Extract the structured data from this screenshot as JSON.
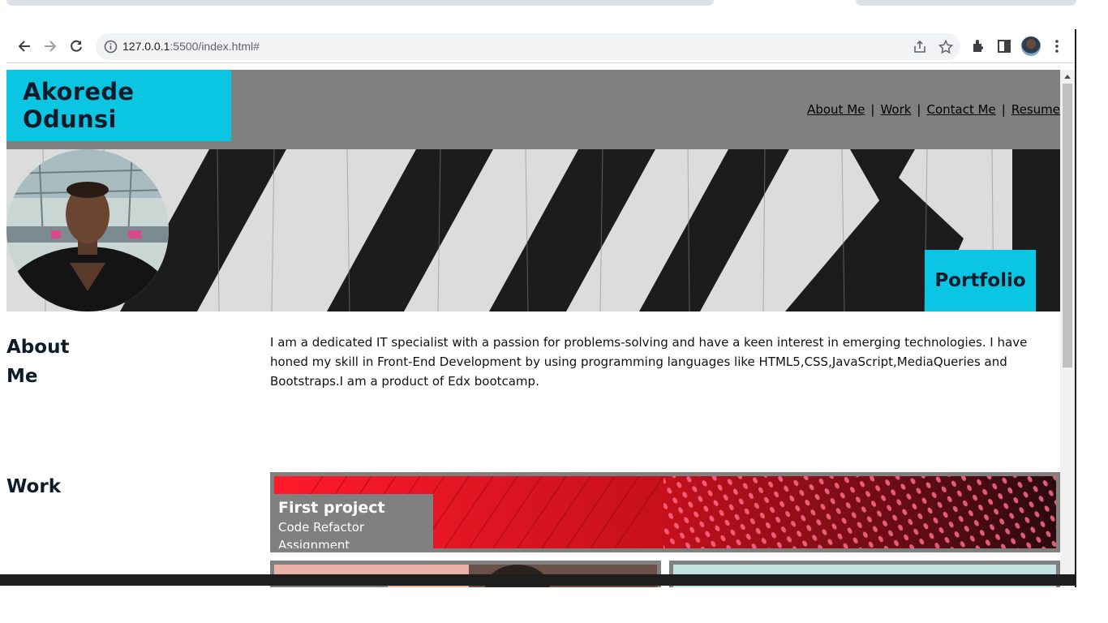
{
  "browser": {
    "url_host": "127.0.0.1",
    "url_path": ":5500/index.html#"
  },
  "site": {
    "logo": "Akorede Odunsi",
    "nav": [
      "About Me",
      "Work",
      "Contact Me",
      "Resume"
    ],
    "nav_separator": "|",
    "hero_tag": "Portfolio",
    "about_title_line1": "About",
    "about_title_line2": "Me",
    "about_text": "I am a dedicated IT specialist with a passion for problems-solving and have a keen interest in emerging technologies. I have honed my skill in Front-End Development by using programming languages like HTML5,CSS,JavaScript,MediaQueries and Bootstraps.I am a product of Edx bootcamp.",
    "work_title": "Work",
    "projects": [
      {
        "title": "First project",
        "subtitle": "Code Refactor Assignment"
      }
    ]
  },
  "colors": {
    "accent": "#0bc6e3",
    "header_bg": "#808080",
    "text": "#0d1b2a"
  }
}
